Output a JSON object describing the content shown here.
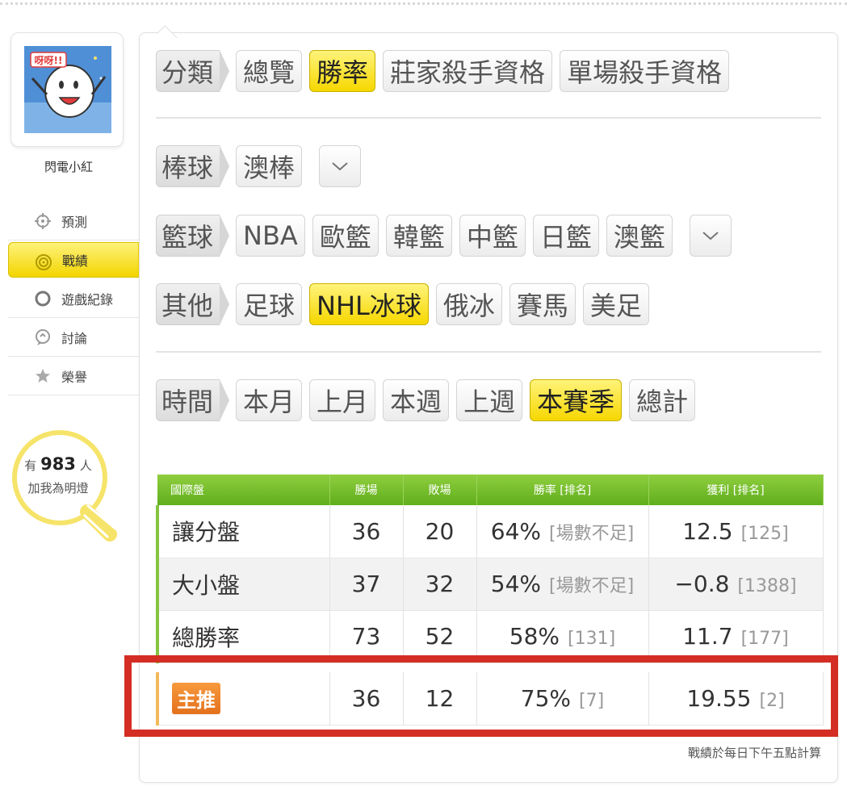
{
  "sidebar": {
    "username": "閃電小紅",
    "avatar_caption": "呀呀!!",
    "nav": [
      {
        "label": "預測",
        "icon": "crosshair-icon"
      },
      {
        "label": "戰績",
        "icon": "target-icon"
      },
      {
        "label": "遊戲紀錄",
        "icon": "circle-icon"
      },
      {
        "label": "討論",
        "icon": "chat-icon"
      },
      {
        "label": "榮譽",
        "icon": "medal-icon"
      }
    ],
    "fans_prefix": "有",
    "fans_count": "983",
    "fans_suffix": "人",
    "fans_line2": "加我為明燈"
  },
  "filters": {
    "category": {
      "label": "分類",
      "options": [
        "總覽",
        "勝率",
        "莊家殺手資格",
        "單場殺手資格"
      ],
      "selected": "勝率"
    },
    "baseball": {
      "label": "棒球",
      "options": [
        "澳棒"
      ]
    },
    "basketball": {
      "label": "籃球",
      "options": [
        "NBA",
        "歐籃",
        "韓籃",
        "中籃",
        "日籃",
        "澳籃"
      ]
    },
    "other": {
      "label": "其他",
      "options": [
        "足球",
        "NHL冰球",
        "俄冰",
        "賽馬",
        "美足"
      ],
      "selected": "NHL冰球"
    },
    "time": {
      "label": "時間",
      "options": [
        "本月",
        "上月",
        "本週",
        "上週",
        "本賽季",
        "總計"
      ],
      "selected": "本賽季"
    }
  },
  "table": {
    "headers": [
      "國際盤",
      "勝場",
      "敗場",
      "勝率 [排名]",
      "獲利 [排名]"
    ],
    "rows": [
      {
        "type": "讓分盤",
        "win": "36",
        "loss": "20",
        "rate": "64%",
        "rate_rank": "[場數不足]",
        "profit": "12.5",
        "profit_rank": "[125]"
      },
      {
        "type": "大小盤",
        "win": "37",
        "loss": "32",
        "rate": "54%",
        "rate_rank": "[場數不足]",
        "profit": "−0.8",
        "profit_rank": "[1388]"
      },
      {
        "type": "總勝率",
        "win": "73",
        "loss": "52",
        "rate": "58%",
        "rate_rank": "[131]",
        "profit": "11.7",
        "profit_rank": "[177]"
      },
      {
        "type": "主推",
        "win": "36",
        "loss": "12",
        "rate": "75%",
        "rate_rank": "[7]",
        "profit": "19.55",
        "profit_rank": "[2]"
      }
    ],
    "footnote": "戰績於每日下午五點計算"
  },
  "colors": {
    "selected": "#f6d700",
    "header_green": "#6cb82a",
    "highlight_red": "#d42e24",
    "tag_orange": "#e8781f"
  }
}
